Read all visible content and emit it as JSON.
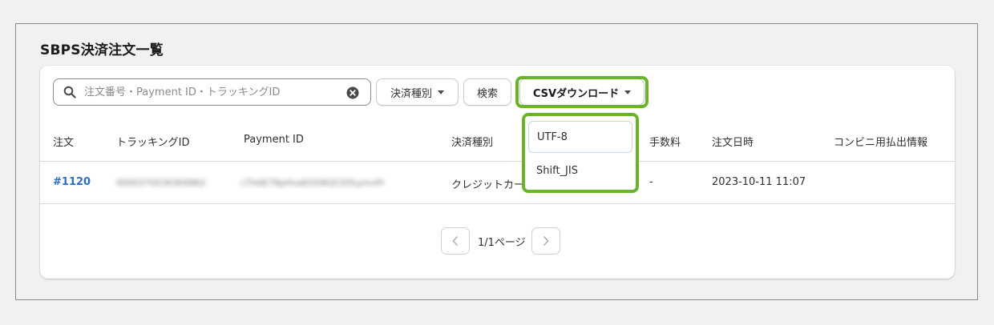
{
  "page": {
    "title": "SBPS決済注文一覧"
  },
  "toolbar": {
    "search_placeholder": "注文番号・Payment ID・トラッキングID",
    "type_filter_label": "決済種別",
    "search_button_label": "検索",
    "csv_download_label": "CSVダウンロード"
  },
  "table": {
    "headers": [
      "注文",
      "トラッキングID",
      "Payment ID",
      "決済種別",
      "手数料",
      "注文日時",
      "コンビニ用払出情報"
    ],
    "rows": [
      {
        "order": "#1120",
        "tracking_id": "00003700363E6862",
        "payment_id": "cTHdE78pHvaEOO6QCD5LymvPr",
        "payment_type": "クレジットカード",
        "fee": "-",
        "ordered_at": "2023-10-11 11:07",
        "konbini_info": ""
      }
    ]
  },
  "pagination": {
    "label": "1/1ページ"
  },
  "csv_menu": {
    "options": [
      "UTF-8",
      "Shift_JIS"
    ]
  },
  "colors": {
    "highlight": "#6ab42a",
    "link": "#2c6ecb"
  }
}
